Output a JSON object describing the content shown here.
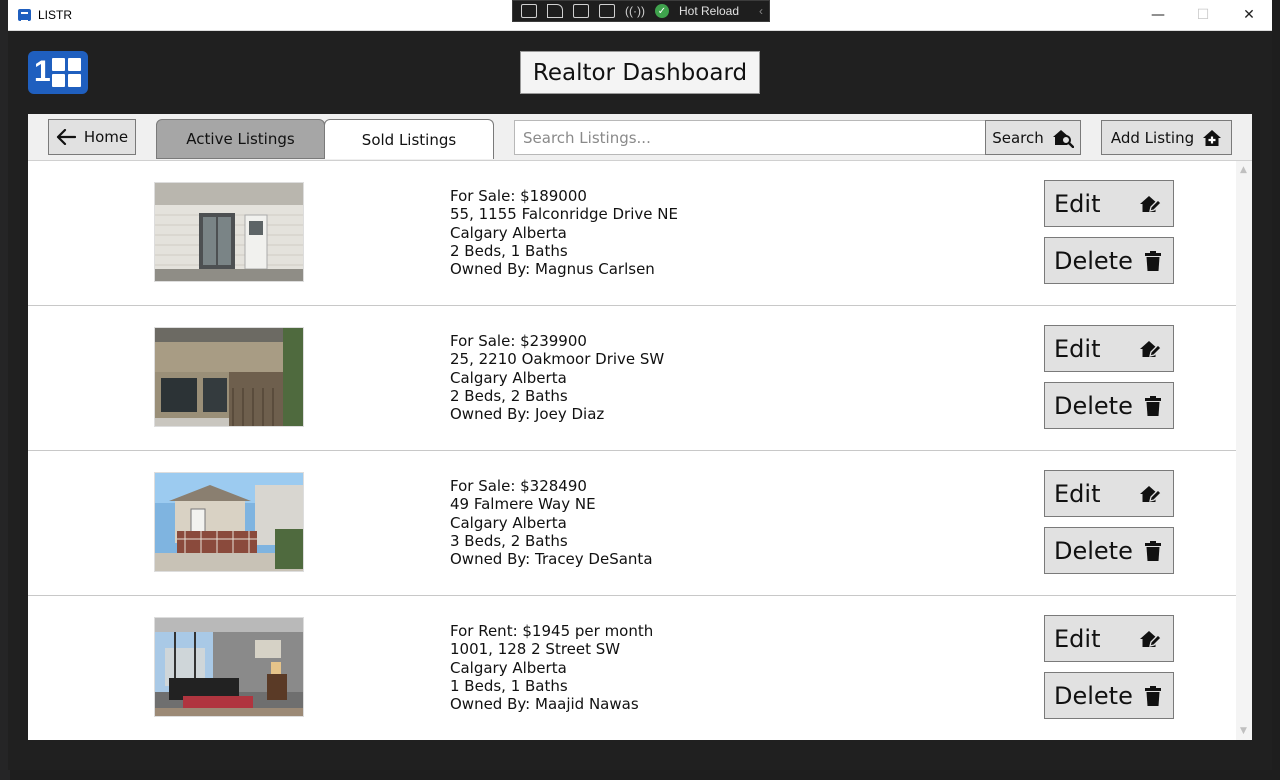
{
  "window": {
    "app_title": "LISTR",
    "hot_reload_label": "Hot Reload",
    "minimize": "—",
    "maximize": "☐",
    "close": "✕"
  },
  "header": {
    "title": "Realtor Dashboard"
  },
  "toolbar": {
    "home_label": "Home",
    "tabs": [
      {
        "label": "Active Listings",
        "selected": true
      },
      {
        "label": "Sold Listings",
        "selected": false
      }
    ],
    "search_placeholder": "Search Listings...",
    "search_value": "",
    "search_label": "Search",
    "add_label": "Add Listing"
  },
  "listings": [
    {
      "price": "For Sale: $189000",
      "address": "55, 1155 Falconridge Drive NE",
      "city": "Calgary Alberta",
      "rooms": "2 Beds, 1 Baths",
      "owner": "Owned By: Magnus Carlsen",
      "edit_label": "Edit",
      "delete_label": "Delete"
    },
    {
      "price": "For Sale: $239900",
      "address": "25, 2210 Oakmoor Drive SW",
      "city": "Calgary Alberta",
      "rooms": "2 Beds, 2 Baths",
      "owner": "Owned By: Joey Diaz",
      "edit_label": "Edit",
      "delete_label": "Delete"
    },
    {
      "price": "For Sale: $328490",
      "address": "49 Falmere Way NE",
      "city": "Calgary Alberta",
      "rooms": "3 Beds, 2 Baths",
      "owner": "Owned By: Tracey DeSanta",
      "edit_label": "Edit",
      "delete_label": "Delete"
    },
    {
      "price": "For Rent: $1945 per month",
      "address": "1001, 128 2 Street SW",
      "city": "Calgary Alberta",
      "rooms": "1 Beds, 1 Baths",
      "owner": "Owned By: Maajid Nawas",
      "edit_label": "Edit",
      "delete_label": "Delete"
    }
  ],
  "colors": {
    "app_background": "#202020",
    "brand_blue": "#1f5fbf",
    "button_bg": "#e1e1e1",
    "active_tab_bg": "#a6a6a6"
  },
  "icons": {
    "home_button": "arrow-left-icon",
    "search_button": "house-search-icon",
    "add_button": "house-plus-icon",
    "edit_button": "house-edit-icon",
    "delete_button": "trash-icon"
  }
}
